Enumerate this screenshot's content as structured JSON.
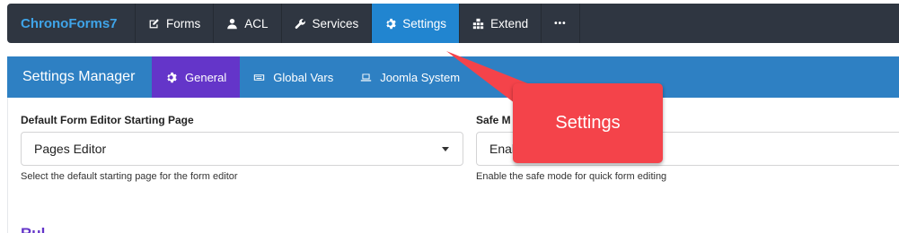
{
  "topnav": {
    "brand": "ChronoForms7",
    "items": [
      {
        "label": "Forms",
        "icon": "edit-icon"
      },
      {
        "label": "ACL",
        "icon": "user-icon"
      },
      {
        "label": "Services",
        "icon": "wrench-icon"
      },
      {
        "label": "Settings",
        "icon": "gear-icon",
        "active": true
      },
      {
        "label": "Extend",
        "icon": "puzzle-icon"
      }
    ],
    "more": "•••"
  },
  "settings_bar": {
    "title": "Settings Manager",
    "tabs": [
      {
        "label": "General",
        "icon": "gear-icon",
        "active": true
      },
      {
        "label": "Global Vars",
        "icon": "keyboard-icon"
      },
      {
        "label": "Joomla System",
        "icon": "laptop-icon"
      }
    ]
  },
  "form": {
    "editor_page": {
      "label": "Default Form Editor Starting Page",
      "value": "Pages Editor",
      "hint": "Select the default starting page for the form editor"
    },
    "safe_mode": {
      "label": "Safe M",
      "value": "Enab",
      "hint": "Enable the safe mode for quick form editing"
    },
    "next_section": "Rul"
  },
  "callout": {
    "text": "Settings"
  },
  "colors": {
    "nav_bg": "#2f3641",
    "nav_active": "#2185d0",
    "brand": "#3fa4e8",
    "secbar_bg": "#2e80c3",
    "tab_active": "#6435c9",
    "callout": "#f4434a"
  }
}
